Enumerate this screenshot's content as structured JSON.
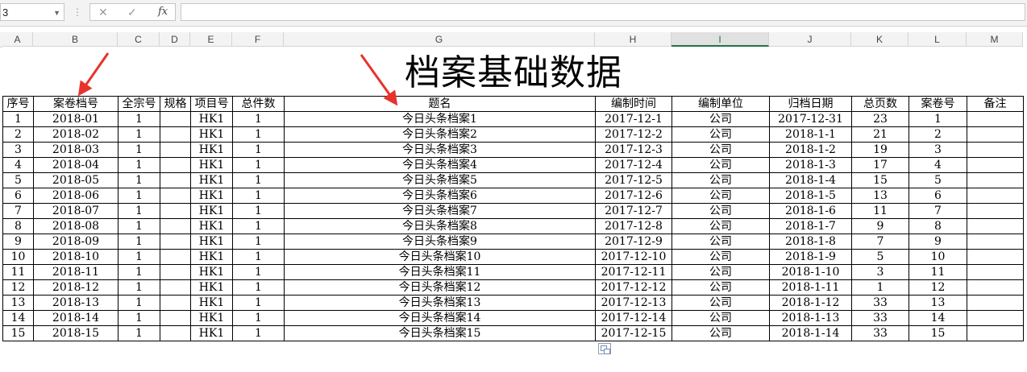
{
  "formula_bar": {
    "name_box": "3",
    "name_box_dropdown_icon": "chevron-down-icon",
    "cancel_icon": "✕",
    "enter_icon": "✓",
    "fx_label": "fx",
    "formula_value": ""
  },
  "columns": [
    "A",
    "B",
    "C",
    "D",
    "E",
    "F",
    "G",
    "H",
    "I",
    "J",
    "K",
    "L",
    "M"
  ],
  "selected_column": "I",
  "sheet": {
    "title": "档案基础数据",
    "headers": [
      "序号",
      "案卷档号",
      "全宗号",
      "规格",
      "项目号",
      "总件数",
      "题名",
      "编制时间",
      "编制单位",
      "归档日期",
      "总页数",
      "案卷号",
      "备注"
    ],
    "rows": [
      [
        "1",
        "2018-01",
        "1",
        "",
        "HK1",
        "1",
        "今日头条档案1",
        "2017-12-1",
        "公司",
        "2017-12-31",
        "23",
        "1",
        ""
      ],
      [
        "2",
        "2018-02",
        "1",
        "",
        "HK1",
        "1",
        "今日头条档案2",
        "2017-12-2",
        "公司",
        "2018-1-1",
        "21",
        "2",
        ""
      ],
      [
        "3",
        "2018-03",
        "1",
        "",
        "HK1",
        "1",
        "今日头条档案3",
        "2017-12-3",
        "公司",
        "2018-1-2",
        "19",
        "3",
        ""
      ],
      [
        "4",
        "2018-04",
        "1",
        "",
        "HK1",
        "1",
        "今日头条档案4",
        "2017-12-4",
        "公司",
        "2018-1-3",
        "17",
        "4",
        ""
      ],
      [
        "5",
        "2018-05",
        "1",
        "",
        "HK1",
        "1",
        "今日头条档案5",
        "2017-12-5",
        "公司",
        "2018-1-4",
        "15",
        "5",
        ""
      ],
      [
        "6",
        "2018-06",
        "1",
        "",
        "HK1",
        "1",
        "今日头条档案6",
        "2017-12-6",
        "公司",
        "2018-1-5",
        "13",
        "6",
        ""
      ],
      [
        "7",
        "2018-07",
        "1",
        "",
        "HK1",
        "1",
        "今日头条档案7",
        "2017-12-7",
        "公司",
        "2018-1-6",
        "11",
        "7",
        ""
      ],
      [
        "8",
        "2018-08",
        "1",
        "",
        "HK1",
        "1",
        "今日头条档案8",
        "2017-12-8",
        "公司",
        "2018-1-7",
        "9",
        "8",
        ""
      ],
      [
        "9",
        "2018-09",
        "1",
        "",
        "HK1",
        "1",
        "今日头条档案9",
        "2017-12-9",
        "公司",
        "2018-1-8",
        "7",
        "9",
        ""
      ],
      [
        "10",
        "2018-10",
        "1",
        "",
        "HK1",
        "1",
        "今日头条档案10",
        "2017-12-10",
        "公司",
        "2018-1-9",
        "5",
        "10",
        ""
      ],
      [
        "11",
        "2018-11",
        "1",
        "",
        "HK1",
        "1",
        "今日头条档案11",
        "2017-12-11",
        "公司",
        "2018-1-10",
        "3",
        "11",
        ""
      ],
      [
        "12",
        "2018-12",
        "1",
        "",
        "HK1",
        "1",
        "今日头条档案12",
        "2017-12-12",
        "公司",
        "2018-1-11",
        "1",
        "12",
        ""
      ],
      [
        "13",
        "2018-13",
        "1",
        "",
        "HK1",
        "1",
        "今日头条档案13",
        "2017-12-13",
        "公司",
        "2018-1-12",
        "33",
        "13",
        ""
      ],
      [
        "14",
        "2018-14",
        "1",
        "",
        "HK1",
        "1",
        "今日头条档案14",
        "2017-12-14",
        "公司",
        "2018-1-13",
        "33",
        "14",
        ""
      ],
      [
        "15",
        "2018-15",
        "1",
        "",
        "HK1",
        "1",
        "今日头条档案15",
        "2017-12-15",
        "公司",
        "2018-1-14",
        "33",
        "15",
        ""
      ]
    ]
  },
  "colors": {
    "grid_header_bg": "#f3f3f3",
    "selected_accent": "#217346",
    "annotation_arrow": "#e8322c"
  },
  "icons": {
    "paste_options": "paste-options-icon"
  }
}
